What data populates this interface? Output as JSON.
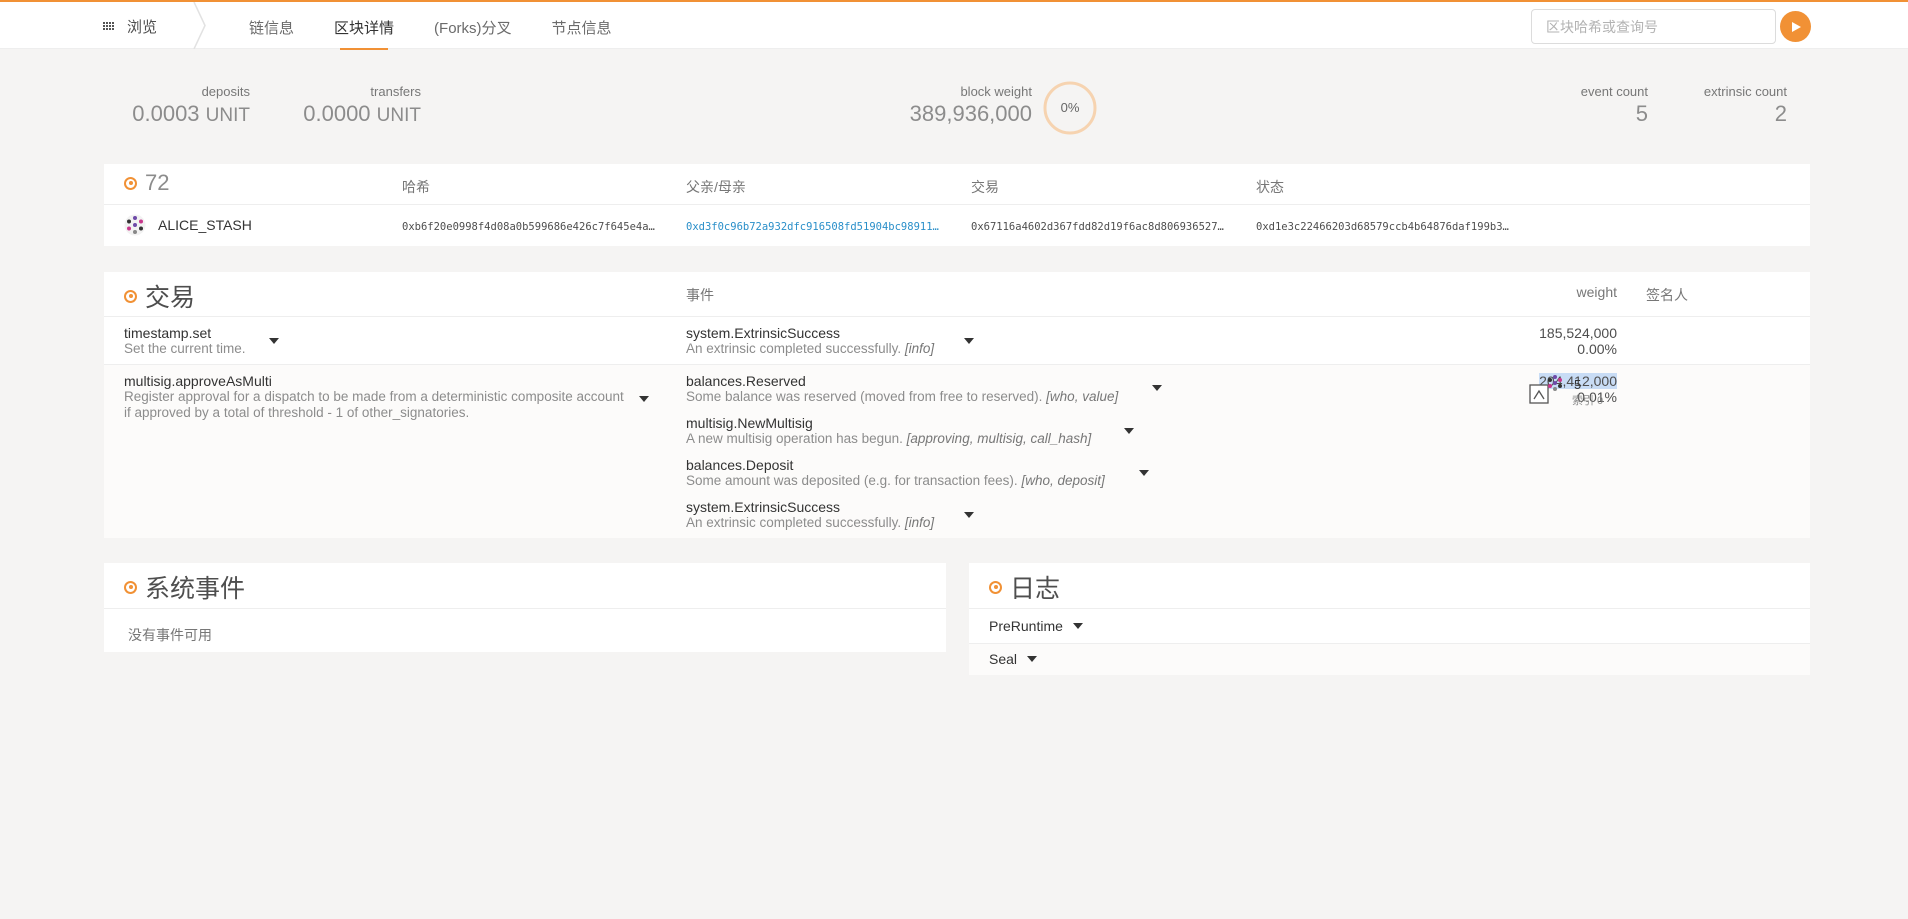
{
  "nav": {
    "brand_label": "浏览",
    "tabs": [
      {
        "label": "链信息"
      },
      {
        "label": "区块详情"
      },
      {
        "label": "(Forks)分叉"
      },
      {
        "label": "节点信息"
      }
    ],
    "search_placeholder": "区块哈希或查询号",
    "accent_color": "#f19135"
  },
  "summary": {
    "deposits": {
      "label": "deposits",
      "value": "0.0003",
      "unit": "UNIT"
    },
    "transfers": {
      "label": "transfers",
      "value": "0.0000",
      "unit": "UNIT"
    },
    "block_weight": {
      "label": "block weight",
      "value": "389,936,000",
      "percent_text": "0%",
      "percent": 0
    },
    "event_count": {
      "label": "event count",
      "value": "5"
    },
    "extrinsic_count": {
      "label": "extrinsic count",
      "value": "2"
    }
  },
  "block": {
    "number": "72",
    "headers": {
      "hash": "哈希",
      "parent": "父亲/母亲",
      "extrinsics": "交易",
      "state": "状态"
    },
    "author": "ALICE_STASH",
    "hash": "0xb6f20e0998f4d08a0b599686e426c7f645e4a…",
    "parent": "0xd3f0c96b72a932dfc916508fd51904bc98911…",
    "extrinsics_root": "0x67116a4602d367fdd82d19f6ac8d806936527…",
    "state_root": "0xd1e3c22466203d68579ccb4b64876daf199b3…"
  },
  "extrinsics": {
    "title": "交易",
    "headers": {
      "events": "事件",
      "weight": "weight",
      "signer": "签名人"
    },
    "rows": [
      {
        "method": "timestamp.set",
        "description": "Set the current time.",
        "events": [
          {
            "method": "system.ExtrinsicSuccess",
            "description": "An extrinsic completed successfully.",
            "args": "[info]"
          }
        ],
        "weight": "185,524,000",
        "weight_pct": "0.00%"
      },
      {
        "method": "multisig.approveAsMulti",
        "description": "Register approval for a dispatch to be made from a deterministic composite account if approved by a total of threshold - 1 of other_signatories.",
        "events": [
          {
            "method": "balances.Reserved",
            "description": "Some balance was reserved (moved from free to reserved).",
            "args": "[who, value]"
          },
          {
            "method": "multisig.NewMultisig",
            "description": "A new multisig operation has begun.",
            "args": "[approving, multisig, call_hash]"
          },
          {
            "method": "balances.Deposit",
            "description": "Some amount was deposited (e.g. for transaction fees).",
            "args": "[who, deposit]"
          },
          {
            "method": "system.ExtrinsicSuccess",
            "description": "An extrinsic completed successfully.",
            "args": "[info]"
          }
        ],
        "weight": "204,412,000",
        "weight_pct": "0.01%",
        "signer_nonce": "5",
        "signer_index": "索引 0"
      }
    ]
  },
  "system_events": {
    "title": "系统事件",
    "empty_text": "没有事件可用"
  },
  "logs": {
    "title": "日志",
    "items": [
      {
        "label": "PreRuntime"
      },
      {
        "label": "Seal"
      }
    ]
  }
}
